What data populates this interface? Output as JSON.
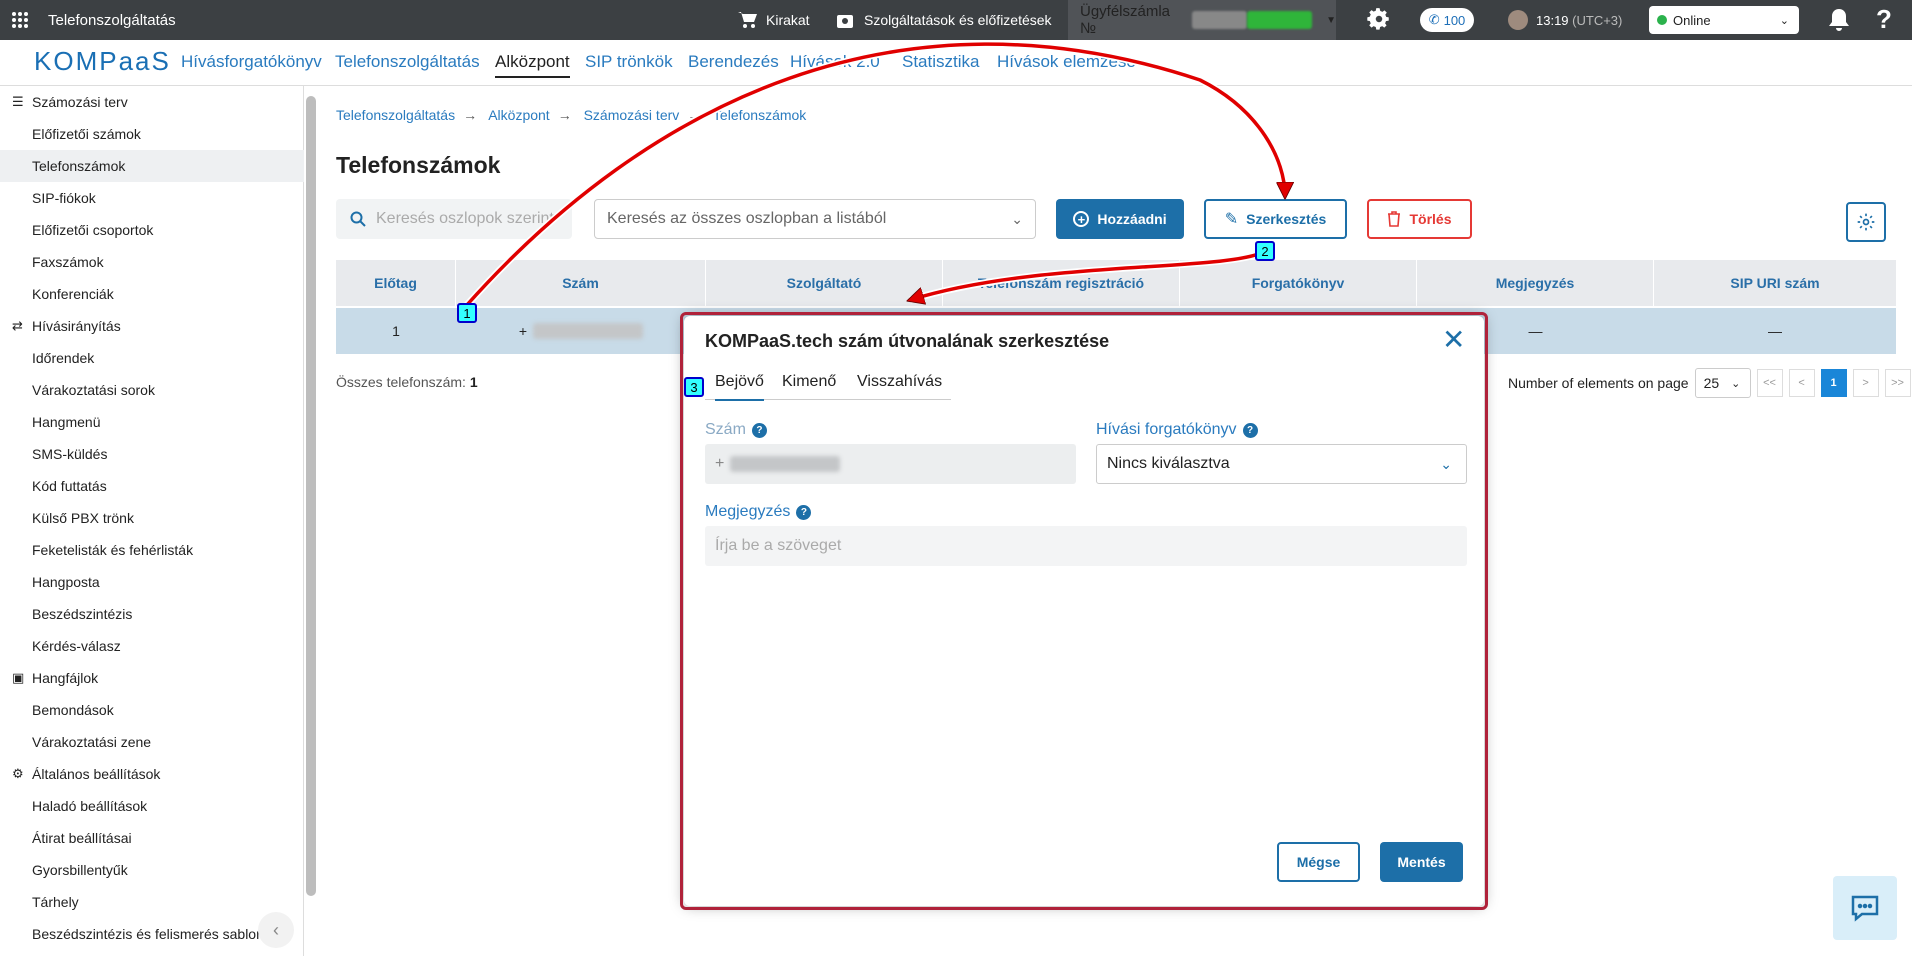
{
  "topbar": {
    "app_title": "Telefonszolgáltatás",
    "cart": "Kirakat",
    "services": "Szolgáltatások és előfizetések",
    "account_prefix": "Ügyfélszámla №",
    "calls_count": "100",
    "time": "13:19",
    "tz": "(UTC+3)",
    "status": "Online"
  },
  "brand": {
    "logo": "KOMPaaS"
  },
  "nav": [
    "Hívásforgatókönyv",
    "Telefonszolgáltatás",
    "Alközpont",
    "SIP trönkök",
    "Berendezés",
    "Hívások 2.0",
    "Statisztika",
    "Hívások elemzése"
  ],
  "sidebar": [
    {
      "label": "Számozási terv",
      "type": "group",
      "icon": "list-icon"
    },
    {
      "label": "Előfizetői számok",
      "type": "child"
    },
    {
      "label": "Telefonszámok",
      "type": "child",
      "selected": true
    },
    {
      "label": "SIP-fiókok",
      "type": "child"
    },
    {
      "label": "Előfizetői csoportok",
      "type": "child"
    },
    {
      "label": "Faxszámok",
      "type": "child"
    },
    {
      "label": "Konferenciák",
      "type": "child"
    },
    {
      "label": "Hívásirányítás",
      "type": "group",
      "icon": "routing-icon"
    },
    {
      "label": "Időrendek",
      "type": "child"
    },
    {
      "label": "Várakoztatási sorok",
      "type": "child"
    },
    {
      "label": "Hangmenü",
      "type": "child"
    },
    {
      "label": "SMS-küldés",
      "type": "child"
    },
    {
      "label": "Kód futtatás",
      "type": "child"
    },
    {
      "label": "Külső PBX trönk",
      "type": "child"
    },
    {
      "label": "Feketelisták és fehérlisták",
      "type": "child"
    },
    {
      "label": "Hangposta",
      "type": "child"
    },
    {
      "label": "Beszédszintézis",
      "type": "child"
    },
    {
      "label": "Kérdés-válasz",
      "type": "child"
    },
    {
      "label": "Hangfájlok",
      "type": "group",
      "icon": "audio-file-icon"
    },
    {
      "label": "Bemondások",
      "type": "child"
    },
    {
      "label": "Várakoztatási zene",
      "type": "child"
    },
    {
      "label": "Általános beállítások",
      "type": "group",
      "icon": "gear-icon"
    },
    {
      "label": "Haladó beállítások",
      "type": "child"
    },
    {
      "label": "Átirat beállításai",
      "type": "child"
    },
    {
      "label": "Gyorsbillentyűk",
      "type": "child"
    },
    {
      "label": "Tárhely",
      "type": "child"
    },
    {
      "label": "Beszédszintézis és felismerés sablon",
      "type": "child"
    }
  ],
  "breadcrumb": [
    "Telefonszolgáltatás",
    "Alközpont",
    "Számozási terv",
    "Telefonszámok"
  ],
  "page": {
    "title": "Telefonszámok",
    "search_placeholder": "Keresés oszlopok szerint",
    "search_all_placeholder": "Keresés az összes oszlopban a listából",
    "add_label": "Hozzáadni",
    "edit_label": "Szerkesztés",
    "delete_label": "Törlés"
  },
  "table": {
    "columns": [
      "Előtag",
      "Szám",
      "Szolgáltató",
      "Telefonszám regisztráció",
      "Forgatókönyv",
      "Megjegyzés",
      "SIP URI szám"
    ],
    "rows": [
      [
        "1",
        "+",
        "",
        "",
        "",
        "—",
        "—"
      ]
    ]
  },
  "footer": {
    "total_label": "Összes telefonszám:",
    "total_value": "1",
    "per_page_label": "Number of elements on page",
    "per_page": "25",
    "pager": [
      "<<",
      "<",
      "1",
      ">",
      ">>"
    ]
  },
  "modal": {
    "title": "KOMPaaS.tech szám útvonalának szerkesztése",
    "tabs": [
      "Bejövő",
      "Kimenő",
      "Visszahívás"
    ],
    "number_label": "Szám",
    "number_value": "+",
    "scenario_label": "Hívási forgatókönyv",
    "scenario_value": "Nincs kiválasztva",
    "note_label": "Megjegyzés",
    "note_placeholder": "Írja be a szöveget",
    "cancel_label": "Mégse",
    "save_label": "Mentés",
    "help": "?"
  },
  "badges": [
    "1",
    "2",
    "3"
  ],
  "colors": {
    "accent": "#1d6fa8",
    "danger": "#e53935",
    "annotation": "#e00000"
  }
}
